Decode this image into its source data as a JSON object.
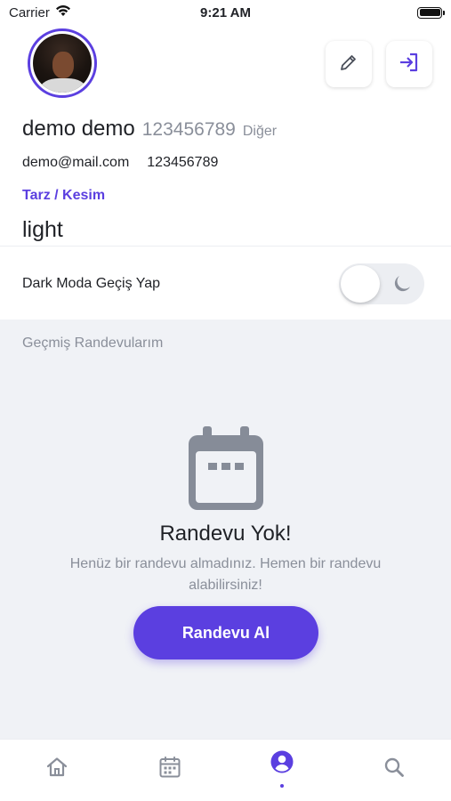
{
  "status_bar": {
    "carrier": "Carrier",
    "time": "9:21 AM"
  },
  "profile": {
    "name": "demo demo",
    "phone_big": "123456789",
    "gender": "Diğer",
    "email": "demo@mail.com",
    "phone": "123456789",
    "style_label": "Tarz / Kesim",
    "style_value": "light"
  },
  "actions": {
    "edit_icon": "pencil-icon",
    "logout_icon": "logout-icon"
  },
  "dark_mode": {
    "label": "Dark Moda Geçiş Yap",
    "enabled": false
  },
  "history": {
    "title": "Geçmiş Randevularım",
    "empty_title": "Randevu Yok!",
    "empty_desc": "Henüz bir randevu almadınız. Hemen bir randevu alabilirsiniz!",
    "cta_label": "Randevu Al"
  },
  "tabbar": {
    "items": [
      "home-icon",
      "calendar-icon",
      "profile-icon",
      "search-icon"
    ],
    "active": "profile-icon"
  },
  "colors": {
    "accent": "#5b3fe0",
    "muted": "#8a8f9a",
    "background": "#f0f2f6"
  }
}
